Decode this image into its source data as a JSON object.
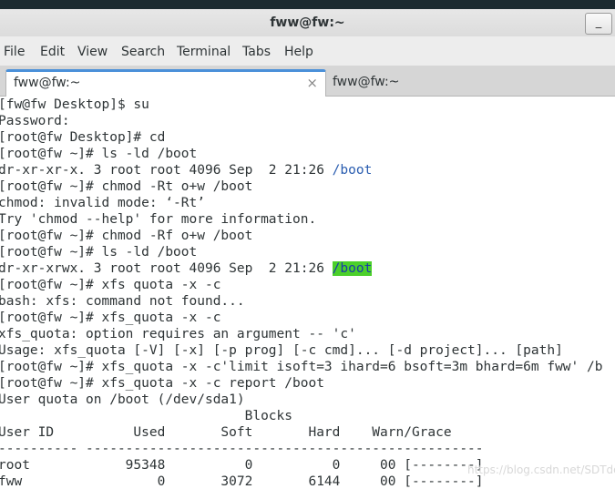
{
  "window": {
    "title": "fww@fw:~",
    "minimize_label": "_"
  },
  "menu": [
    "File",
    "Edit",
    "View",
    "Search",
    "Terminal",
    "Tabs",
    "Help"
  ],
  "tabs": [
    {
      "label": "fww@fw:~",
      "close": "×"
    },
    {
      "label": "fww@fw:~"
    }
  ],
  "terminal": {
    "lines": [
      "[fw@fw Desktop]$ su",
      "Password:",
      "[root@fw Desktop]# cd",
      "[root@fw ~]# ls -ld /boot",
      "dr-xr-xr-x. 3 root root 4096 Sep  2 21:26 ",
      "[root@fw ~]# chmod -Rt o+w /boot",
      "chmod: invalid mode: ‘-Rt’",
      "Try 'chmod --help' for more information.",
      "[root@fw ~]# chmod -Rf o+w /boot",
      "[root@fw ~]# ls -ld /boot",
      "dr-xr-xrwx. 3 root root 4096 Sep  2 21:26 ",
      "[root@fw ~]# xfs quota -x -c",
      "bash: xfs: command not found...",
      "[root@fw ~]# xfs_quota -x -c",
      "xfs_quota: option requires an argument -- 'c'",
      "Usage: xfs_quota [-V] [-x] [-p prog] [-c cmd]... [-d project]... [path]",
      "[root@fw ~]# xfs_quota -x -c'limit isoft=3 ihard=6 bsoft=3m bhard=6m fww' /b",
      "[root@fw ~]# xfs_quota -x -c report /boot",
      "User quota on /boot (/dev/sda1)",
      "                               Blocks",
      "User ID          Used       Soft       Hard    Warn/Grace",
      "---------- --------------------------------------------------",
      "root            95348          0          0     00 [--------]",
      "fww                 0       3072       6144     00 [--------]"
    ],
    "dir_boot_1": "/boot",
    "dir_boot_2": "/boot"
  },
  "watermark": "https://blog.csdn.net/SDTdd"
}
